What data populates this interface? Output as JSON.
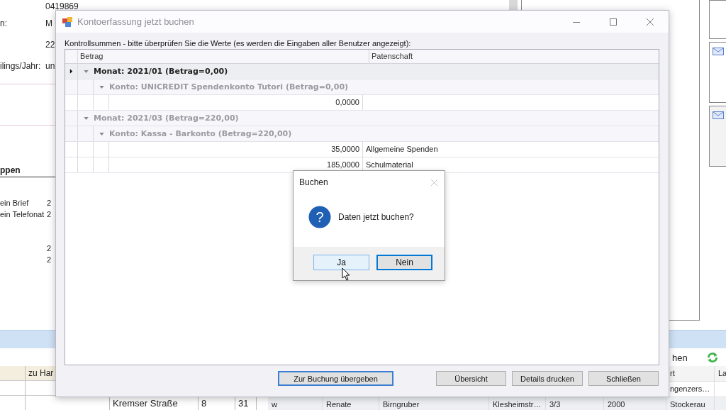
{
  "background": {
    "fields": [
      {
        "value": "0419869"
      },
      {
        "label": "n:",
        "value": "M"
      },
      {
        "value": "22"
      },
      {
        "label": "ilings/Jahr:",
        "value": "un"
      }
    ],
    "section_title": "ppen",
    "contacts": [
      {
        "label": "ein Brief",
        "value": "2"
      },
      {
        "label": "ein Telefonat",
        "value": "2"
      }
    ],
    "totals": [
      "2",
      "2"
    ],
    "toolbar_text": "hen",
    "grid_left": {
      "header": "zu Har",
      "row": [
        "Kremser Straße",
        "8",
        "31"
      ]
    },
    "grid_right": {
      "header": [
        "rt",
        "La"
      ],
      "rows": [
        [
          "",
          "",
          "",
          "",
          "",
          "",
          "ngenzers…"
        ],
        [
          "w",
          "Renate",
          "Birngruber",
          "Klesheimstr…",
          "3/3",
          "2000",
          "Stockerau"
        ]
      ]
    }
  },
  "dialog": {
    "title": "Kontoerfassung jetzt buchen",
    "instruction": "Kontrollsummen - bitte überprüfen Sie die Werte (es werden die Eingaben aller Benutzer angezeigt):",
    "columns": [
      "Betrag",
      "Patenschaft"
    ],
    "groups": [
      {
        "label": "Monat: 2021/01 (Betrag=0,00)",
        "selected": true,
        "children": [
          {
            "label": "Konto: UNICREDIT Spendenkonto Tutori (Betrag=0,00)",
            "rows": [
              {
                "betrag": "0,0000"
              }
            ]
          }
        ]
      },
      {
        "label": "Monat: 2021/03 (Betrag=220,00)",
        "selected": false,
        "children": [
          {
            "label": "Konto: Kassa - Barkonto (Betrag=220,00)",
            "rows": [
              {
                "betrag": "35,0000",
                "patenschaft": "Allgemeine Spenden"
              },
              {
                "betrag": "185,0000",
                "patenschaft": "Schulmaterial"
              }
            ]
          }
        ]
      }
    ],
    "buttons": [
      {
        "label": "Zur Buchung übergeben",
        "default": true
      },
      {
        "label": "Übersicht",
        "default": false
      },
      {
        "label": "Details drucken",
        "default": false
      },
      {
        "label": "Schließen",
        "default": false
      }
    ]
  },
  "message_box": {
    "title": "Buchen",
    "icon": "?",
    "message": "Daten jetzt buchen?",
    "buttons": [
      {
        "label": "Ja",
        "focused": false,
        "hovered": true
      },
      {
        "label": "Nein",
        "focused": true,
        "hovered": false
      }
    ]
  }
}
